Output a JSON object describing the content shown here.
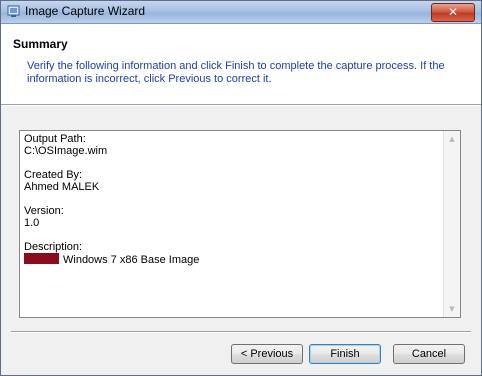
{
  "window": {
    "title": "Image Capture Wizard",
    "close_label": "✕",
    "title_icon": "wizard-window-icon"
  },
  "header": {
    "heading": "Summary",
    "instructions": "Verify the following information and click Finish to complete the capture process.  If the information is incorrect, click Previous to correct it."
  },
  "summary": {
    "output_path_label": "Output Path:",
    "output_path_value": "C:\\OSImage.wim",
    "created_by_label": "Created By:",
    "created_by_value": "Ahmed MALEK",
    "version_label": "Version:",
    "version_value": "1.0",
    "description_label": "Description:",
    "description_value": "Windows 7 x86 Base Image",
    "redaction_color": "#8b0a1c"
  },
  "buttons": {
    "previous": "< Previous",
    "finish": "Finish",
    "cancel": "Cancel"
  },
  "colors": {
    "instruction_text": "#1c3fa8",
    "close_button": "#c13a20"
  }
}
